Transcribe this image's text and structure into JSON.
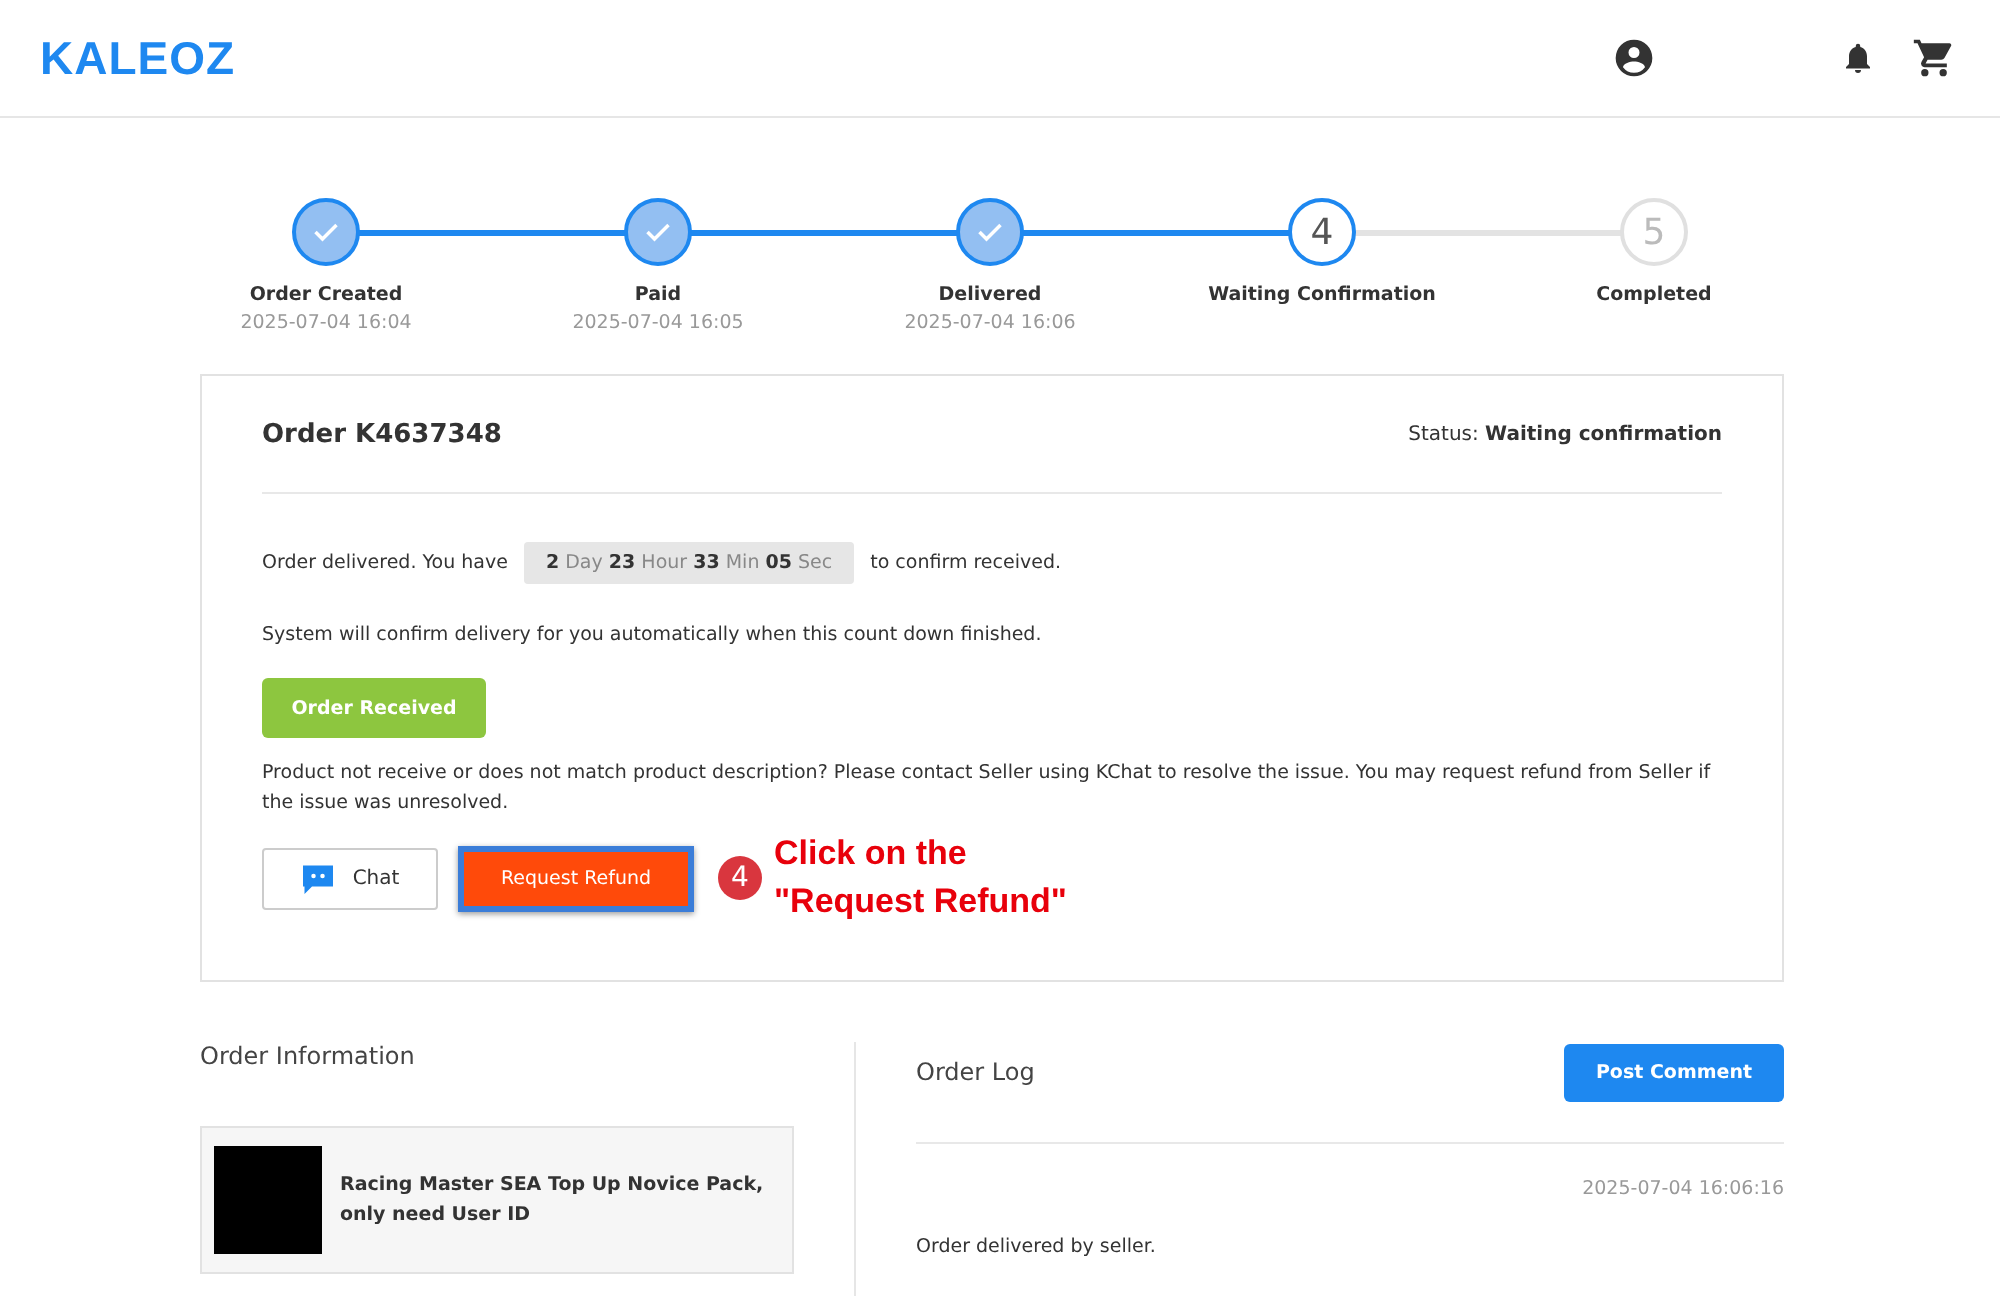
{
  "header": {
    "logo": "KALEOZ"
  },
  "steps": [
    {
      "label": "Order Created",
      "time": "2025-07-04 16:04",
      "kind": "done"
    },
    {
      "label": "Paid",
      "time": "2025-07-04 16:05",
      "kind": "done"
    },
    {
      "label": "Delivered",
      "time": "2025-07-04 16:06",
      "kind": "done"
    },
    {
      "number": "4",
      "label": "Waiting Confirmation",
      "kind": "current"
    },
    {
      "number": "5",
      "label": "Completed",
      "kind": "pending"
    }
  ],
  "order": {
    "title": "Order K4637348",
    "status_label": "Status:",
    "status_value": "Waiting confirmation",
    "delivered_before": "Order delivered. You have",
    "delivered_after": "to confirm received.",
    "countdown": [
      {
        "value": "2",
        "unit": "Day"
      },
      {
        "value": "23",
        "unit": "Hour"
      },
      {
        "value": "33",
        "unit": "Min"
      },
      {
        "value": "05",
        "unit": "Sec"
      }
    ],
    "auto_confirm": "System will confirm delivery for you automatically when this count down finished.",
    "received_button": "Order Received",
    "issue_text": "Product not receive or does not match product description? Please contact Seller using KChat to resolve the issue. You may request refund from Seller if the issue was unresolved.",
    "chat_button": "Chat",
    "refund_button": "Request Refund"
  },
  "annotation": {
    "badge": "4",
    "lines": [
      "Click on the",
      "\"Request Refund\""
    ]
  },
  "order_information": {
    "title": "Order Information",
    "product_name": "Racing Master SEA Top Up Novice Pack, only need User ID"
  },
  "order_log": {
    "title": "Order Log",
    "button": "Post Comment",
    "entries": [
      {
        "time": "2025-07-04 16:06:16",
        "text": "Order delivered by seller."
      }
    ]
  }
}
